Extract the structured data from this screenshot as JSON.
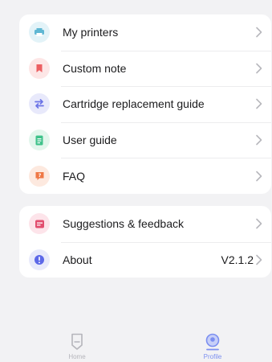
{
  "menu_group_1": [
    {
      "label": "My printers",
      "icon": "printer-icon",
      "icon_bg": "#e3f3f8",
      "icon_color": "#5fb7d3"
    },
    {
      "label": "Custom note",
      "icon": "bookmark-icon",
      "icon_bg": "#fde6e6",
      "icon_color": "#ec5f62"
    },
    {
      "label": "Cartridge replacement guide",
      "icon": "swap-arrows-icon",
      "icon_bg": "#e8e9fb",
      "icon_color": "#6c74e6"
    },
    {
      "label": "User guide",
      "icon": "document-icon",
      "icon_bg": "#e2f6ec",
      "icon_color": "#3fc28a"
    },
    {
      "label": "FAQ",
      "icon": "question-chat-icon",
      "icon_bg": "#fde9df",
      "icon_color": "#ef7845"
    }
  ],
  "menu_group_2": [
    {
      "label": "Suggestions & feedback",
      "icon": "feedback-icon",
      "icon_bg": "#fde4ea",
      "icon_color": "#e24e6f"
    },
    {
      "label": "About",
      "icon": "info-icon",
      "icon_bg": "#e8eafb",
      "icon_color": "#5c68e8",
      "value": "V2.1.2"
    }
  ],
  "tabbar": {
    "home": {
      "label": "Home",
      "icon": "home-printer-icon",
      "active": false
    },
    "profile": {
      "label": "Profile",
      "icon": "profile-icon",
      "active": true
    }
  },
  "colors": {
    "background": "#f2f2f4",
    "card": "#ffffff",
    "chevron": "#b8b8bd",
    "active_tab": "#7c8ff0",
    "inactive_tab": "#b5b5bb"
  }
}
